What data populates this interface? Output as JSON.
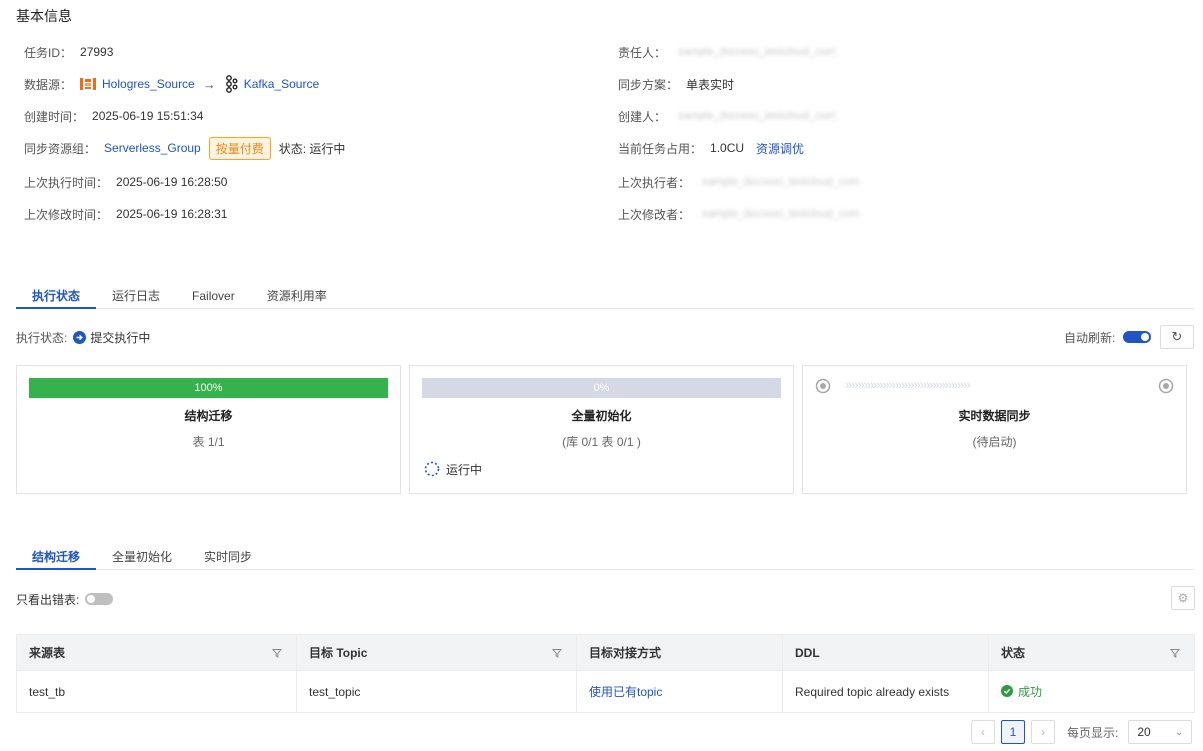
{
  "section_title": "基本信息",
  "info_left": [
    {
      "label": "任务ID：",
      "value": "27993"
    },
    {
      "label": "数据源：",
      "source": "Hologres_Source",
      "target": "Kafka_Source"
    },
    {
      "label": "创建时间：",
      "value": "2025-06-19 15:51:34"
    },
    {
      "label": "同步资源组：",
      "value": "Serverless_Group",
      "tag": "按量付费",
      "status": "状态: 运行中"
    },
    {
      "label": "上次执行时间：",
      "value": "2025-06-19 16:28:50"
    },
    {
      "label": "上次修改时间：",
      "value": "2025-06-19 16:28:31"
    }
  ],
  "info_right": [
    {
      "label": "责任人：",
      "value": "sample_docreso_testcloud_com"
    },
    {
      "label": "同步方案：",
      "value": "单表实时"
    },
    {
      "label": "创建人：",
      "value": "sample_docreso_testcloud_com"
    },
    {
      "label": "当前任务占用：",
      "value": "1.0CU",
      "link": "资源调优"
    },
    {
      "label": "上次执行者：",
      "value": "sample_docreso_testcloud_com"
    },
    {
      "label": "上次修改者：",
      "value": "sample_docreso_testcloud_com"
    }
  ],
  "main_tabs": [
    "执行状态",
    "运行日志",
    "Failover",
    "资源利用率"
  ],
  "exec_status": {
    "label": "执行状态:",
    "value": "提交执行中"
  },
  "auto_refresh": {
    "label": "自动刷新:",
    "enabled": true
  },
  "cards": [
    {
      "progress_text": "100%",
      "progress": 1.0,
      "title": "结构迁移",
      "sub": "表 1/1"
    },
    {
      "progress_text": "0%",
      "progress": 0.0,
      "title": "全量初始化",
      "sub": "(库 0/1 表 0/1 )",
      "running": "运行中"
    },
    {
      "title": "实时数据同步",
      "sub": "(待启动)"
    }
  ],
  "sub_tabs": [
    "结构迁移",
    "全量初始化",
    "实时同步"
  ],
  "error_only": {
    "label": "只看出错表:",
    "enabled": false
  },
  "table": {
    "columns": [
      "来源表",
      "目标 Topic",
      "目标对接方式",
      "DDL",
      "状态"
    ],
    "rows": [
      {
        "source": "test_tb",
        "topic": "test_topic",
        "mode": "使用已有topic",
        "ddl": "Required topic already exists",
        "status": "成功"
      }
    ]
  },
  "pagination": {
    "current": "1",
    "per_page_label": "每页显示:",
    "per_page": "20"
  },
  "colors": {
    "accent": "#1f55c4",
    "success": "#35b24b",
    "tag": "#e8891a"
  }
}
